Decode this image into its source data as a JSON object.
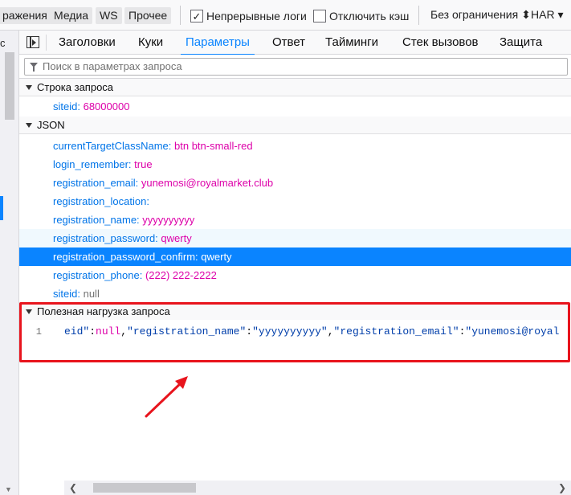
{
  "toolbar": {
    "filters": [
      "ражения",
      "Медиа",
      "WS",
      "Прочее"
    ],
    "persist_logs": {
      "label": "Непрерывные логи",
      "checked": "✓"
    },
    "disable_cache": {
      "label": "Отключить кэш",
      "checked": ""
    },
    "throttling": "Без ограничения ⬍",
    "har": "HAR ▾"
  },
  "left_strip": {
    "cut_text": "c"
  },
  "tabs": [
    "Заголовки",
    "Куки",
    "Параметры",
    "Ответ",
    "Тайминги",
    "Стек вызовов",
    "Защита"
  ],
  "active_tab": "Параметры",
  "search": {
    "placeholder": "Поиск в параметрах запроса"
  },
  "query_section": {
    "title": "Строка запроса",
    "rows": [
      {
        "key": "siteid:",
        "value": "68000000"
      }
    ]
  },
  "json_section": {
    "title": "JSON",
    "rows": [
      {
        "key": "currentTargetClassName:",
        "value": "btn btn-small-red"
      },
      {
        "key": "login_remember:",
        "value": "true"
      },
      {
        "key": "registration_email:",
        "value": "yunemosi@royalmarket.club"
      },
      {
        "key": "registration_location:",
        "value": ""
      },
      {
        "key": "registration_name:",
        "value": "yyyyyyyyyy"
      },
      {
        "key": "registration_password:",
        "value": "qwerty"
      },
      {
        "key": "registration_password_confirm:",
        "value": "qwerty"
      },
      {
        "key": "registration_phone:",
        "value": "(222) 222-2222"
      },
      {
        "key": "siteid:",
        "value": "null"
      }
    ]
  },
  "payload_section": {
    "title": "Полезная нагрузка запроса",
    "line_number": "1",
    "code": {
      "p1": "eid\"",
      "p2": ":",
      "p3": "null",
      "p4": ",",
      "p5": "\"registration_name\"",
      "p6": ":",
      "p7": "\"yyyyyyyyyy\"",
      "p8": ",",
      "p9": "\"registration_email\"",
      "p10": ":",
      "p11": "\"yunemosi@royal"
    }
  },
  "scroll": {
    "left": "❮",
    "right": "❯"
  },
  "colors": {
    "accent": "#0a84ff",
    "annotation": "#e8141d"
  }
}
